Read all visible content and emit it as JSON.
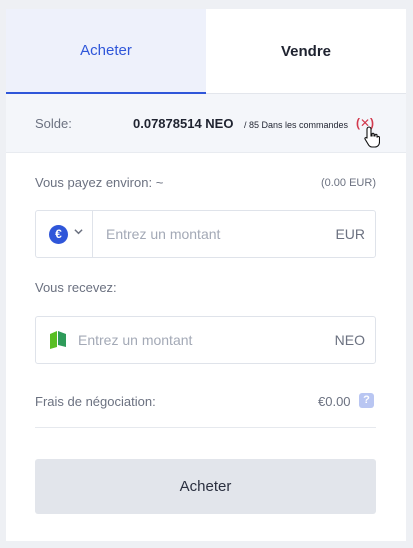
{
  "tabs": {
    "buy": "Acheter",
    "sell": "Vendre"
  },
  "balance": {
    "label": "Solde:",
    "value": "0.07878514 NEO",
    "in_orders": "/ 85 Dans les commandes",
    "close_symbol": "(✕)"
  },
  "pay": {
    "label": "Vous payez environ: ~",
    "estimate": "(0.00 EUR)",
    "placeholder": "Entrez un montant",
    "currency": "EUR",
    "currency_icon": "€"
  },
  "receive": {
    "label": "Vous recevez:",
    "placeholder": "Entrez un montant",
    "currency": "NEO"
  },
  "fee": {
    "label": "Frais de négociation:",
    "value": "€0.00",
    "help_symbol": "?"
  },
  "submit": {
    "label": "Acheter"
  },
  "colors": {
    "accent": "#2f56d9",
    "danger": "#d23a4e",
    "neo": "#58be23"
  }
}
